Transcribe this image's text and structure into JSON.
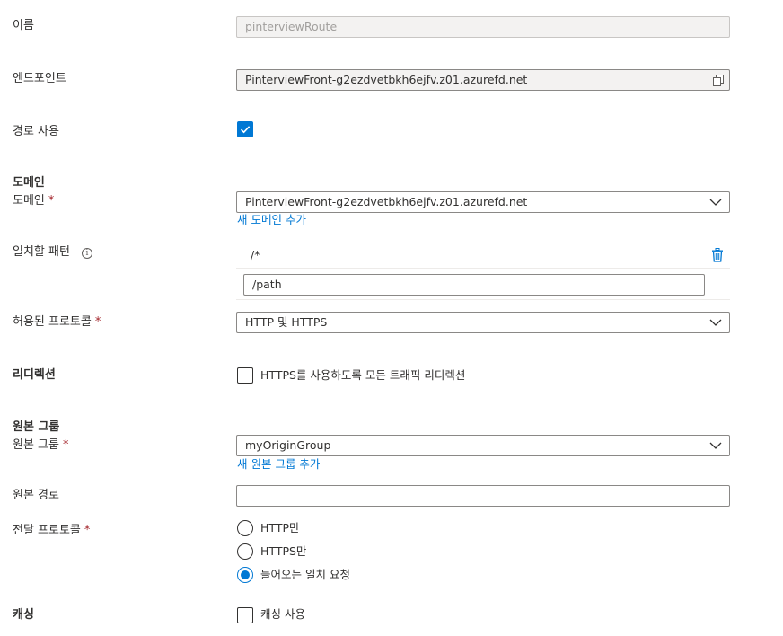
{
  "name": {
    "label": "이름",
    "value": "pinterviewRoute"
  },
  "endpoint": {
    "label": "엔드포인트",
    "value": "PinterviewFront-g2ezdvetbkh6ejfv.z01.azurefd.net"
  },
  "enable_route": {
    "label": "경로 사용",
    "checked": true
  },
  "domains": {
    "section_title": "도메인",
    "label": "도메인",
    "required_mark": "*",
    "value": "PinterviewFront-g2ezdvetbkh6ejfv.z01.azurefd.net",
    "add_link": "새 도메인 추가"
  },
  "patterns": {
    "label": "일치할 패턴",
    "info_glyph": "i",
    "items": [
      "/*"
    ],
    "input_value": "/path"
  },
  "protocols": {
    "label": "허용된 프로토콜",
    "required_mark": "*",
    "value": "HTTP 및 HTTPS"
  },
  "redirect": {
    "section_title": "리디렉션",
    "checkbox_label": "HTTPS를 사용하도록 모든 트래픽 리디렉션",
    "checked": false
  },
  "origin_group": {
    "section_title": "원본 그룹",
    "label": "원본 그룹",
    "required_mark": "*",
    "value": "myOriginGroup",
    "add_link": "새 원본 그룹 추가"
  },
  "origin_path": {
    "label": "원본 경로",
    "value": ""
  },
  "forwarding_protocol": {
    "label": "전달 프로토콜",
    "required_mark": "*",
    "options": [
      "HTTP만",
      "HTTPS만",
      "들어오는 일치 요청"
    ],
    "selected": "들어오는 일치 요청"
  },
  "caching": {
    "section_title": "캐싱",
    "checkbox_label": "캐싱 사용",
    "checked": false
  },
  "colors": {
    "accent": "#0078d4",
    "required": "#a4262c",
    "text": "#323130",
    "disabled_bg": "#f3f2f1"
  }
}
